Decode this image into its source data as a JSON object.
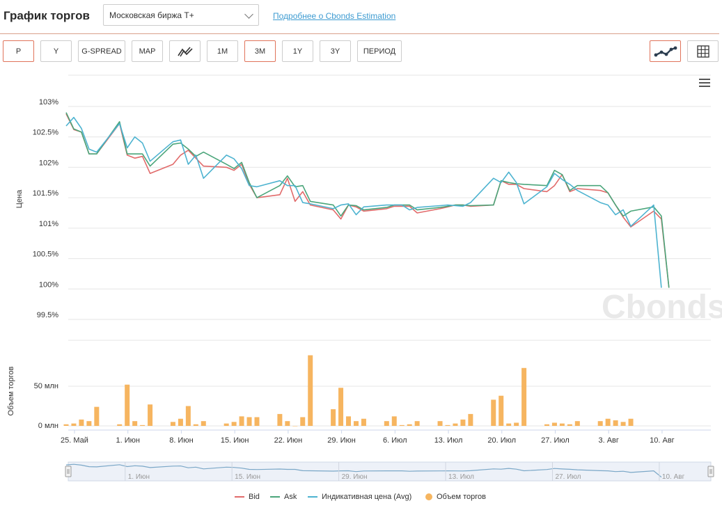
{
  "header": {
    "title": "График торгов",
    "exchange": "Московская биржа Т+",
    "more_link": "Подробнее о Cbonds Estimation"
  },
  "toolbar": {
    "buttons": [
      {
        "label": "P",
        "active": true
      },
      {
        "label": "Y",
        "active": false
      },
      {
        "label": "G-SPREAD",
        "active": false
      },
      {
        "label": "MAP",
        "active": false
      },
      {
        "label": "",
        "icon": "zigzag-icon",
        "active": false
      },
      {
        "label": "1M",
        "active": false
      },
      {
        "label": "3M",
        "active": true
      },
      {
        "label": "1Y",
        "active": false
      },
      {
        "label": "3Y",
        "active": false
      },
      {
        "label": "ПЕРИОД",
        "active": false
      }
    ],
    "view_line_icon": "line-chart-icon",
    "view_table_icon": "table-grid-icon"
  },
  "watermark": "Cbonds",
  "colors": {
    "bid": "#e16a6a",
    "ask": "#4aa57a",
    "avg": "#4db3d0",
    "volume": "#f6b560",
    "accent": "#e0735a"
  },
  "chart_data": {
    "type": "line",
    "ylabel": "Цена",
    "ylabel2": "Объем торгов",
    "ylim": [
      99.5,
      103
    ],
    "yticks": [
      "103%",
      "102.5%",
      "102%",
      "101.5%",
      "101%",
      "100.5%",
      "100%",
      "99.5%"
    ],
    "volume_ylim": [
      0,
      50
    ],
    "volume_ticks": [
      "50 млн",
      "0 млн"
    ],
    "xtick_labels": [
      "25. Май",
      "1. Июн",
      "8. Июн",
      "15. Июн",
      "22. Июн",
      "29. Июн",
      "6. Июл",
      "13. Июл",
      "20. Июл",
      "27. Июл",
      "3. Авг",
      "10. Авг"
    ],
    "navigator_labels": [
      "1. Июн",
      "15. Июн",
      "29. Июн",
      "13. Июл",
      "27. Июл",
      "10. Авг"
    ],
    "x": [
      "2020-05-25",
      "2020-05-26",
      "2020-05-27",
      "2020-05-28",
      "2020-05-29",
      "2020-06-01",
      "2020-06-02",
      "2020-06-03",
      "2020-06-04",
      "2020-06-05",
      "2020-06-08",
      "2020-06-09",
      "2020-06-10",
      "2020-06-11",
      "2020-06-12",
      "2020-06-15",
      "2020-06-16",
      "2020-06-17",
      "2020-06-18",
      "2020-06-19",
      "2020-06-22",
      "2020-06-23",
      "2020-06-24",
      "2020-06-25",
      "2020-06-26",
      "2020-06-29",
      "2020-06-30",
      "2020-07-01",
      "2020-07-02",
      "2020-07-03",
      "2020-07-06",
      "2020-07-07",
      "2020-07-08",
      "2020-07-09",
      "2020-07-10",
      "2020-07-13",
      "2020-07-14",
      "2020-07-15",
      "2020-07-16",
      "2020-07-17",
      "2020-07-20",
      "2020-07-21",
      "2020-07-22",
      "2020-07-23",
      "2020-07-24",
      "2020-07-27",
      "2020-07-28",
      "2020-07-29",
      "2020-07-30",
      "2020-07-31",
      "2020-08-03",
      "2020-08-04",
      "2020-08-05",
      "2020-08-06",
      "2020-08-07",
      "2020-08-10",
      "2020-08-11",
      "2020-08-12",
      "2020-08-13",
      "2020-08-14"
    ],
    "series": [
      {
        "name": "Bid",
        "values": [
          102.88,
          102.62,
          102.58,
          102.22,
          102.22,
          102.72,
          102.2,
          102.15,
          102.18,
          101.9,
          102.05,
          102.2,
          102.28,
          102.15,
          102.02,
          102.0,
          101.95,
          102.05,
          101.72,
          101.5,
          101.55,
          101.82,
          101.44,
          101.6,
          101.38,
          101.3,
          101.15,
          101.38,
          101.35,
          101.28,
          101.32,
          101.36,
          101.36,
          101.36,
          101.25,
          101.32,
          101.35,
          101.38,
          101.38,
          101.36,
          101.38,
          101.78,
          101.72,
          101.72,
          101.65,
          101.6,
          101.7,
          101.88,
          101.6,
          101.65,
          101.62,
          101.58,
          101.38,
          101.18,
          101.02,
          101.28,
          101.15,
          100.02,
          null,
          null
        ]
      },
      {
        "name": "Ask",
        "values": [
          102.9,
          102.63,
          102.58,
          102.22,
          102.22,
          102.75,
          102.22,
          102.22,
          102.22,
          102.02,
          102.38,
          102.4,
          102.3,
          102.18,
          102.25,
          102.05,
          101.98,
          102.08,
          101.75,
          101.5,
          101.7,
          101.86,
          101.68,
          101.7,
          101.44,
          101.38,
          101.2,
          101.38,
          101.37,
          101.3,
          101.34,
          101.38,
          101.38,
          101.38,
          101.3,
          101.34,
          101.36,
          101.38,
          101.38,
          101.37,
          101.38,
          101.78,
          101.75,
          101.73,
          101.72,
          101.7,
          101.95,
          101.88,
          101.62,
          101.7,
          101.7,
          101.58,
          101.38,
          101.2,
          101.28,
          101.35,
          101.2,
          100.02,
          null,
          null
        ]
      },
      {
        "name": "Индикативная цена (Avg)",
        "values": [
          102.68,
          102.82,
          102.64,
          102.3,
          102.25,
          102.72,
          102.32,
          102.5,
          102.4,
          102.1,
          102.42,
          102.45,
          102.05,
          102.2,
          101.82,
          102.2,
          102.14,
          101.98,
          101.7,
          101.68,
          101.78,
          101.7,
          101.7,
          101.42,
          101.4,
          101.32,
          101.38,
          101.4,
          101.22,
          101.35,
          101.38,
          101.38,
          101.38,
          101.3,
          101.34,
          101.37,
          101.38,
          101.37,
          101.36,
          101.42,
          101.82,
          101.75,
          101.92,
          101.75,
          101.4,
          101.68,
          101.9,
          101.8,
          101.72,
          101.62,
          101.42,
          101.38,
          101.22,
          101.3,
          101.03,
          101.38,
          100.02,
          null,
          null,
          null
        ]
      }
    ],
    "volume_values": [
      2,
      3,
      8,
      6,
      24,
      2,
      52,
      6,
      1,
      27,
      5,
      9,
      25,
      2,
      6,
      3,
      5,
      12,
      11,
      11,
      15,
      6,
      0,
      11,
      89,
      21,
      48,
      12,
      6,
      9,
      6,
      12,
      1,
      2,
      6,
      6,
      1,
      3,
      8,
      15,
      33,
      38,
      3,
      4,
      73,
      2,
      4,
      3,
      2,
      6,
      6,
      9,
      7,
      5,
      9
    ]
  },
  "legend": [
    {
      "label": "Bid",
      "kind": "line",
      "color_key": "bid"
    },
    {
      "label": "Ask",
      "kind": "line",
      "color_key": "ask"
    },
    {
      "label": "Индикативная цена (Avg)",
      "kind": "line",
      "color_key": "avg"
    },
    {
      "label": "Объем торгов",
      "kind": "dot",
      "color_key": "volume"
    }
  ]
}
